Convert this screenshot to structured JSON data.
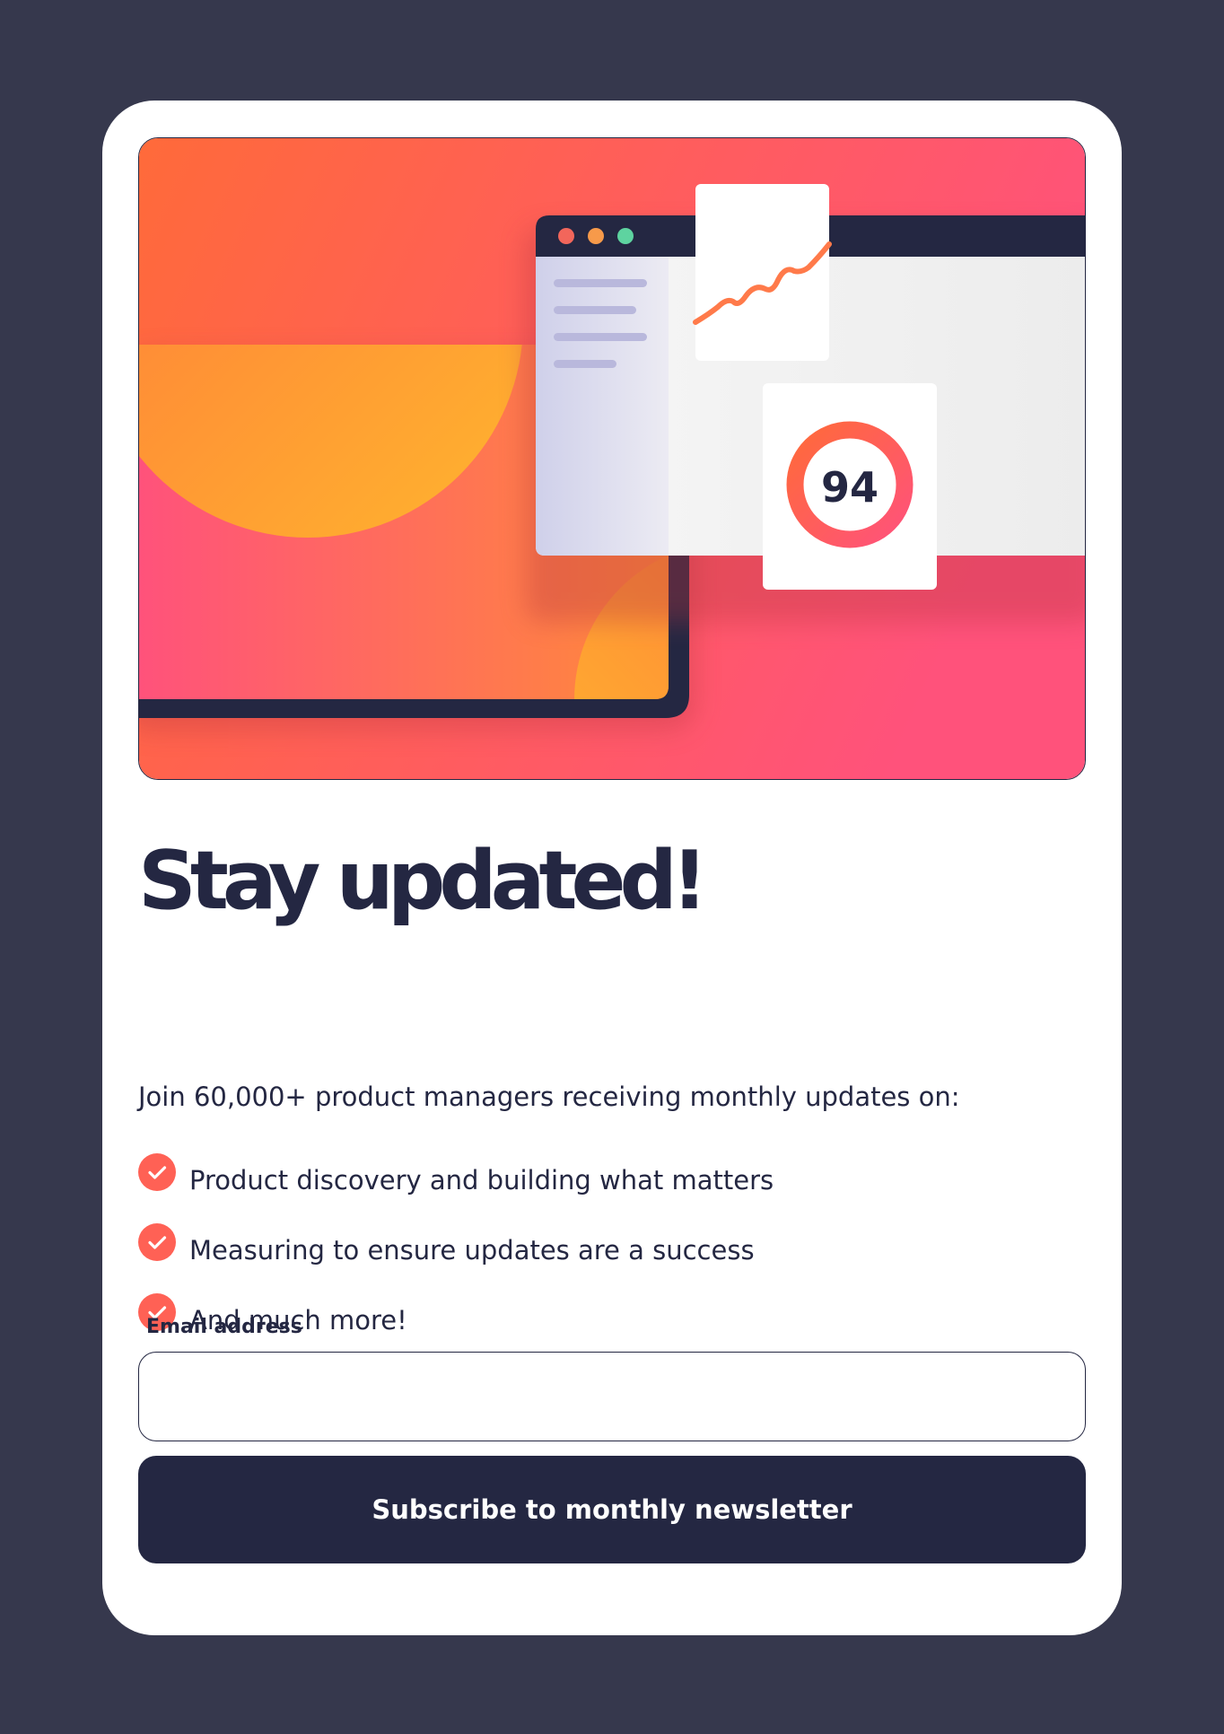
{
  "signup": {
    "title": "Stay updated!",
    "intro": "Join 60,000+ product managers receiving monthly updates on:",
    "features": [
      {
        "label": "Product discovery and building what matters",
        "icon": "check-circle-icon"
      },
      {
        "label": "Measuring to ensure updates are a success",
        "icon": "check-circle-icon"
      },
      {
        "label": "And much more!",
        "icon": "check-circle-icon"
      }
    ],
    "form": {
      "email_label": "Email address",
      "email_value": "",
      "email_placeholder": "",
      "submit_label": "Subscribe to monthly newsletter"
    }
  },
  "illustration": {
    "score": "94",
    "window_dot_colors": [
      "#f2665b",
      "#f79a4a",
      "#5ed3a0"
    ]
  },
  "colors": {
    "page_background": "#36384d",
    "card_background": "#ffffff",
    "dark_navy": "#242742",
    "tomato": "#ff6155",
    "gradient_pink": "#ff527b",
    "gradient_orange": "#ff6a3a"
  }
}
